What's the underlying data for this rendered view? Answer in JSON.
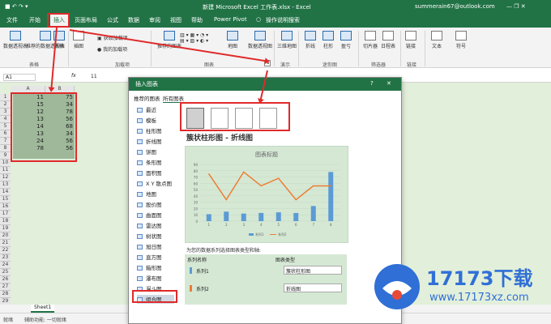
{
  "titlebar": {
    "filename": "新建 Microsoft Excel 工作表.xlsx - Excel",
    "account": "summerain67@outlook.com"
  },
  "tabs": [
    "文件",
    "开始",
    "插入",
    "页面布局",
    "公式",
    "数据",
    "审阅",
    "视图",
    "帮助",
    "Power Pivot",
    "操作说明搜索"
  ],
  "ribbon": {
    "pivot": "数据透视表",
    "rec_pivot": "推荐的数据透视表",
    "table": "表格",
    "group_tables": "表格",
    "illustration": "插图",
    "get_addins": "获取加载项",
    "my_addins": "我的加载项",
    "group_addins": "加载项",
    "rec_charts": "推荐的图表",
    "maps": "地图",
    "pivot_chart": "数据透视图",
    "group_charts": "图表",
    "map3d": "三维地图",
    "group_tours": "演示",
    "line": "折线",
    "column": "柱形",
    "winloss": "盈亏",
    "group_spark": "迷你图",
    "slicer": "切片器",
    "timeline": "日程表",
    "group_filter": "筛选器",
    "link": "链接",
    "group_link": "链接",
    "text": "文本",
    "symbol": "符号"
  },
  "formula": {
    "namebox": "A1",
    "fx": "fx",
    "value": "11"
  },
  "columns": [
    "A",
    "B"
  ],
  "rows": [
    [
      "1",
      "11",
      "75"
    ],
    [
      "2",
      "15",
      "34"
    ],
    [
      "3",
      "12",
      "78"
    ],
    [
      "4",
      "13",
      "56"
    ],
    [
      "5",
      "14",
      "68"
    ],
    [
      "6",
      "13",
      "34"
    ],
    [
      "7",
      "24",
      "56"
    ],
    [
      "8",
      "78",
      "56"
    ],
    [
      "9",
      "",
      ""
    ],
    [
      "10",
      "",
      ""
    ],
    [
      "11",
      "",
      ""
    ],
    [
      "12",
      "",
      ""
    ],
    [
      "13",
      "",
      ""
    ],
    [
      "14",
      "",
      ""
    ],
    [
      "15",
      "",
      ""
    ],
    [
      "16",
      "",
      ""
    ],
    [
      "17",
      "",
      ""
    ],
    [
      "18",
      "",
      ""
    ],
    [
      "19",
      "",
      ""
    ],
    [
      "20",
      "",
      ""
    ],
    [
      "21",
      "",
      ""
    ],
    [
      "22",
      "",
      ""
    ],
    [
      "23",
      "",
      ""
    ],
    [
      "24",
      "",
      ""
    ],
    [
      "25",
      "",
      ""
    ],
    [
      "26",
      "",
      ""
    ],
    [
      "27",
      "",
      ""
    ],
    [
      "28",
      "",
      ""
    ],
    [
      "29",
      "",
      ""
    ]
  ],
  "sheet_tab": "Sheet1",
  "status": {
    "ready": "就绪",
    "access": "辅助功能: 一切就绪"
  },
  "dialog": {
    "title": "插入图表",
    "help": "?",
    "close": "✕",
    "tab_recommended": "推荐的图表",
    "tab_all": "所有图表",
    "categories": [
      "最近",
      "模板",
      "柱形图",
      "折线图",
      "饼图",
      "条形图",
      "面积图",
      "X Y 散点图",
      "地图",
      "股价图",
      "曲面图",
      "雷达图",
      "树状图",
      "旭日图",
      "直方图",
      "箱形图",
      "瀑布图",
      "漏斗图",
      "组合图"
    ],
    "combo_title": "簇状柱形图 - 折线图",
    "preview_title": "图表标题",
    "series_prompt": "为您的数据系列选择图表类型和轴:",
    "col_series": "系列名称",
    "col_type": "图表类型",
    "series": [
      {
        "name": "系列1",
        "type": "簇状柱形图",
        "color": "#5b9bd5"
      },
      {
        "name": "系列2",
        "type": "折线图",
        "color": "#ed7d31"
      }
    ]
  },
  "watermark": {
    "brand": "17173下载",
    "url": "www.17173xz.com"
  },
  "chart_data": {
    "type": "bar",
    "title": "图表标题",
    "categories": [
      "1",
      "2",
      "3",
      "4",
      "5",
      "6",
      "7",
      "8"
    ],
    "series": [
      {
        "name": "系列1",
        "type": "column",
        "values": [
          11,
          15,
          12,
          13,
          14,
          13,
          24,
          78
        ]
      },
      {
        "name": "系列2",
        "type": "line",
        "values": [
          75,
          34,
          78,
          56,
          68,
          34,
          56,
          56
        ]
      }
    ],
    "ylim": [
      0,
      90
    ],
    "yticks": [
      0,
      10,
      20,
      30,
      40,
      50,
      60,
      70,
      80,
      90
    ],
    "legend": "bottom"
  }
}
